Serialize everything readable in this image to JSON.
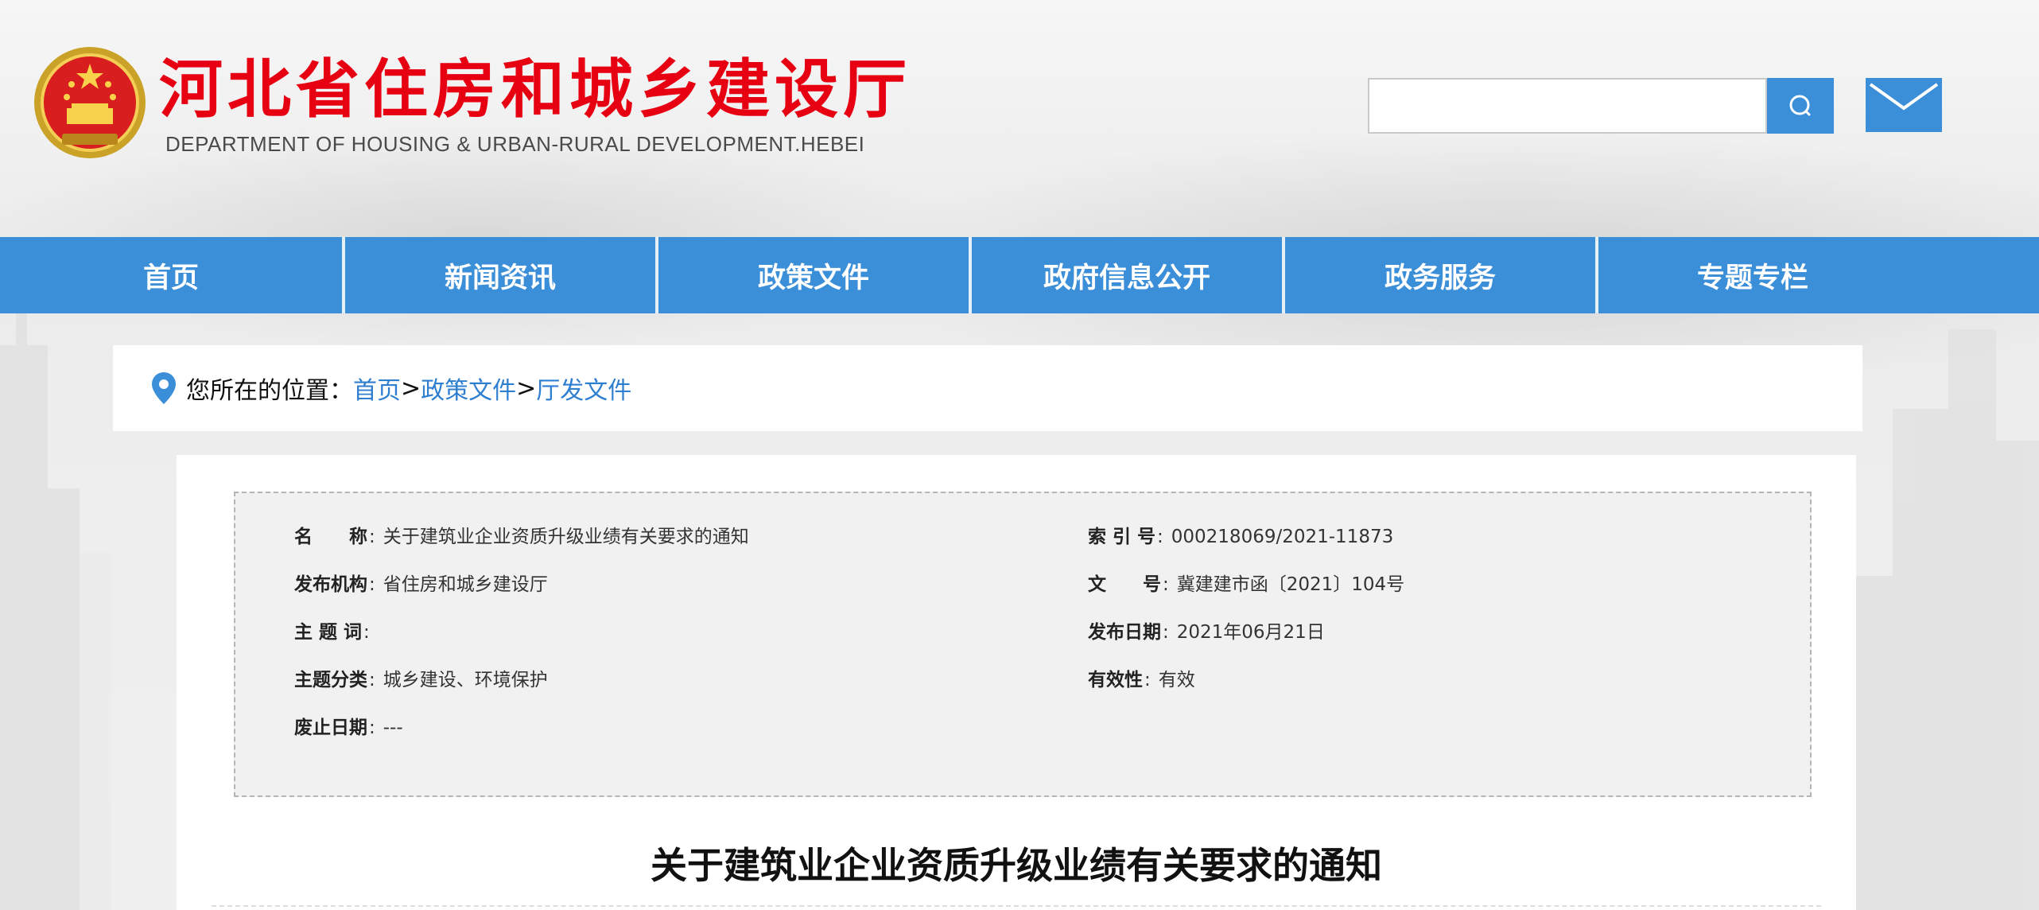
{
  "header": {
    "title_cn": "河北省住房和城乡建设厅",
    "title_en": "DEPARTMENT OF HOUSING & URBAN-RURAL DEVELOPMENT.HEBEI",
    "emblem_icon": "national-emblem-icon",
    "search_placeholder": "",
    "search_icon": "search-icon",
    "mail_icon": "mail-icon"
  },
  "nav": {
    "items": [
      "首页",
      "新闻资讯",
      "政策文件",
      "政府信息公开",
      "政务服务",
      "专题专栏"
    ]
  },
  "breadcrumb": {
    "prefix": "您所在的位置：",
    "items": [
      "首页",
      "政策文件",
      "厅发文件"
    ],
    "separator": ">"
  },
  "meta": {
    "name_key": "名　　称",
    "name_value": "关于建筑业企业资质升级业绩有关要求的通知",
    "index_key": "索 引 号",
    "index_value": "000218069/2021-11873",
    "issuer_key": "发布机构",
    "issuer_value": "省住房和城乡建设厅",
    "docno_key": "文　　号",
    "docno_value": "冀建建市函〔2021〕104号",
    "subject_key": "主 题 词",
    "subject_value": "",
    "date_key": "发布日期",
    "date_value": "2021年06月21日",
    "category_key": "主题分类",
    "category_value": "城乡建设、环境保护",
    "validity_key": "有效性",
    "validity_value": "有效",
    "expiry_key": "废止日期",
    "expiry_value": "---"
  },
  "document": {
    "title": "关于建筑业企业资质升级业绩有关要求的通知"
  },
  "colors": {
    "brand_red": "#e60012",
    "nav_blue": "#3b8ed8",
    "link_blue": "#2f7fd0"
  }
}
